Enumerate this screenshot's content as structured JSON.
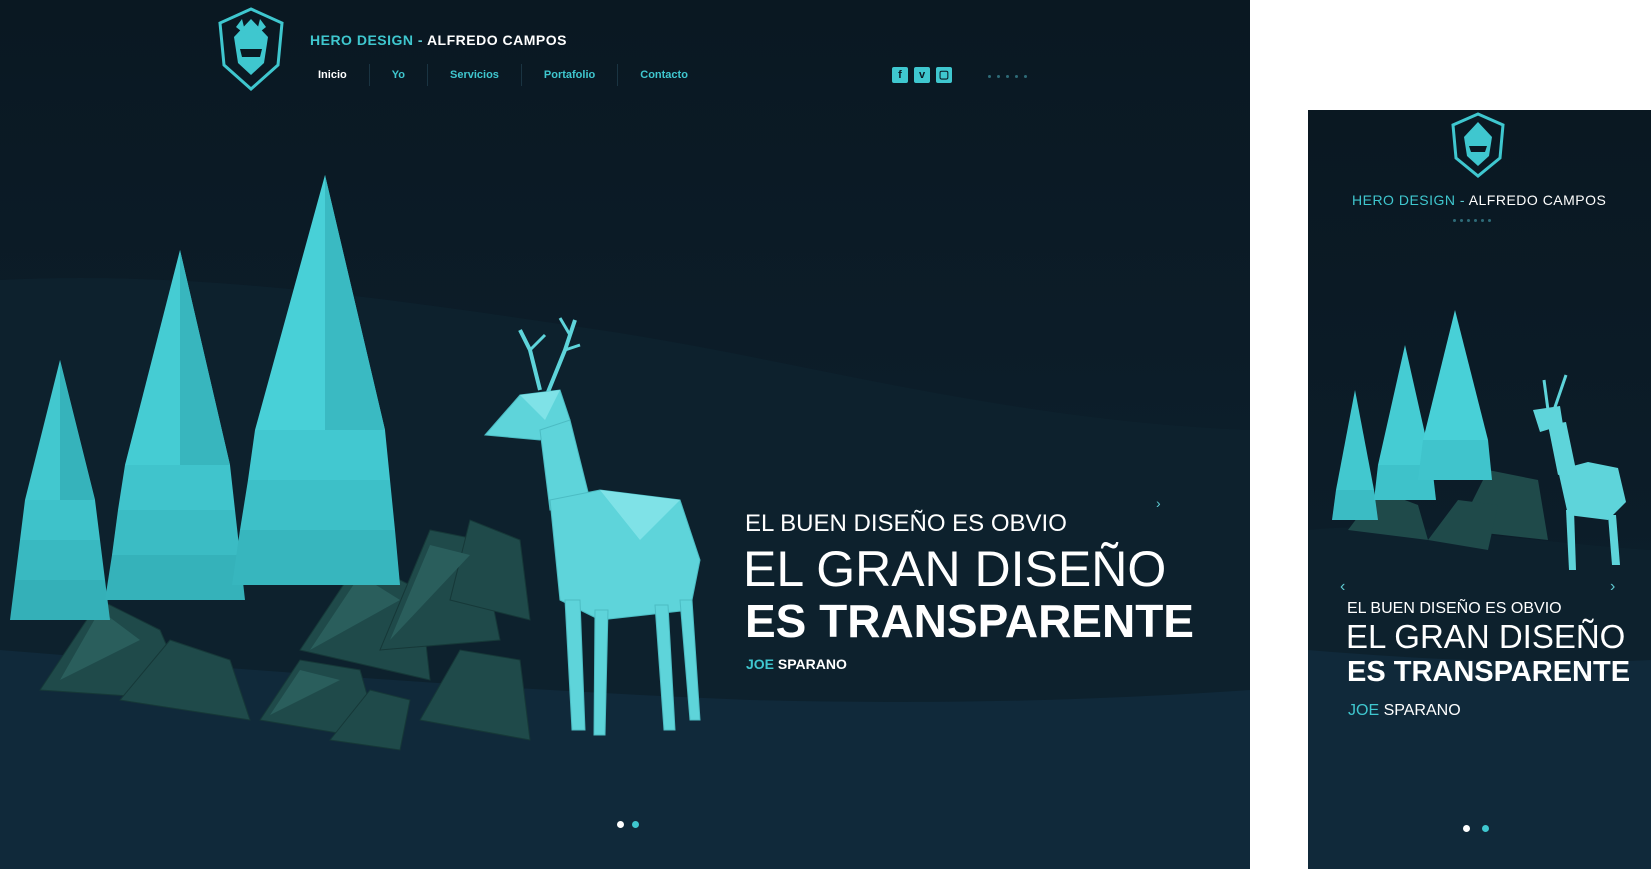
{
  "brand": {
    "part1": "HERO DESIGN",
    "separator": " - ",
    "part2": "ALFREDO CAMPOS"
  },
  "nav": {
    "items": [
      "Inicio",
      "Yo",
      "Servicios",
      "Portafolio",
      "Contacto"
    ],
    "active": "Inicio"
  },
  "social": [
    "facebook-icon",
    "vimeo-icon",
    "instagram-icon"
  ],
  "hero": {
    "line1": "EL BUEN DISEÑO ES OBVIO",
    "line2": "EL GRAN DISEÑO",
    "line3": "ES TRANSPARENTE",
    "author_first": "JOE",
    "author_last": "SPARANO"
  },
  "colors": {
    "accent": "#3fc7cf",
    "background": "#0a1822",
    "text": "#ffffff"
  },
  "slider": {
    "total": 2,
    "current": 2
  }
}
